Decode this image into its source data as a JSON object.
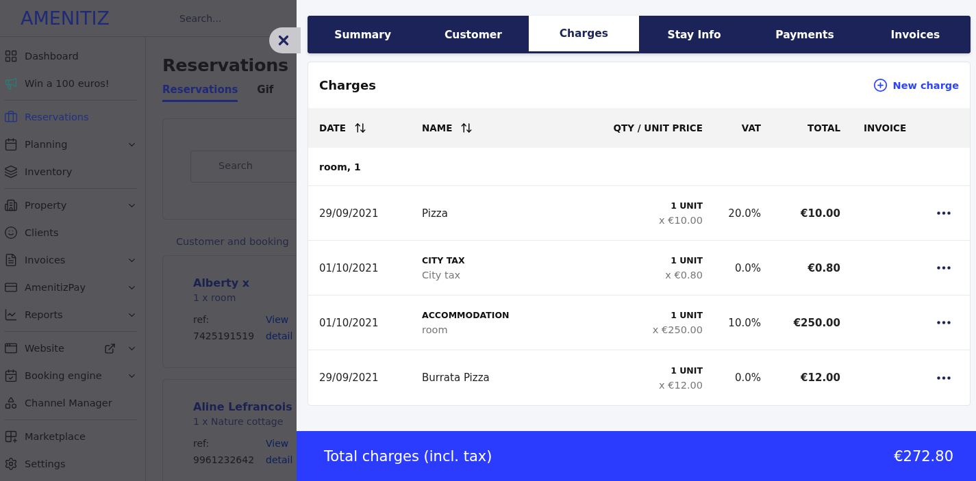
{
  "app": {
    "logo": "AMENITIZ",
    "search_placeholder": "Search..."
  },
  "sidebar": {
    "groups": [
      [
        {
          "label": "Dashboard",
          "selected": false,
          "expandable": false,
          "external": false
        },
        {
          "label": "Win a 100 euros!",
          "selected": false,
          "expandable": false,
          "external": false
        }
      ],
      [
        {
          "label": "Reservations",
          "selected": true,
          "expandable": false,
          "external": false
        },
        {
          "label": "Planning",
          "selected": false,
          "expandable": true,
          "external": false
        },
        {
          "label": "Inventory",
          "selected": false,
          "expandable": false,
          "external": false
        }
      ],
      [
        {
          "label": "Property",
          "selected": false,
          "expandable": true,
          "external": false
        },
        {
          "label": "Clients",
          "selected": false,
          "expandable": false,
          "external": false
        },
        {
          "label": "Invoices",
          "selected": false,
          "expandable": true,
          "external": false
        },
        {
          "label": "AmenitizPay",
          "selected": false,
          "expandable": true,
          "external": false
        },
        {
          "label": "Reports",
          "selected": false,
          "expandable": true,
          "external": false
        }
      ],
      [
        {
          "label": "Website",
          "selected": false,
          "expandable": true,
          "external": true
        },
        {
          "label": "Booking engine",
          "selected": false,
          "expandable": true,
          "external": false
        },
        {
          "label": "Channel Manager",
          "selected": false,
          "expandable": false,
          "external": false
        }
      ],
      [
        {
          "label": "Marketplace",
          "selected": false,
          "expandable": false,
          "external": false
        },
        {
          "label": "Settings",
          "selected": false,
          "expandable": false,
          "external": false
        }
      ]
    ]
  },
  "page": {
    "title": "Reservations",
    "tabs": [
      {
        "label": "Reservations",
        "selected": true
      },
      {
        "label": "Gif",
        "selected": false
      }
    ],
    "search_placeholder": "Search",
    "section_label": "Customer and booking",
    "bookings": [
      {
        "name": "Alberty x",
        "room": "1 x room",
        "ref_label": "ref:",
        "ref": "7425191519",
        "link_1": "View",
        "link_2": "detail"
      },
      {
        "name": "Aline Lefrancois",
        "room": "1 x Nature cottage",
        "ref_label": "ref:",
        "ref": "9961232642",
        "link_1": "View",
        "link_2": "detail"
      }
    ]
  },
  "drawer": {
    "tabs": [
      {
        "label": "Summary",
        "selected": false
      },
      {
        "label": "Customer",
        "selected": false
      },
      {
        "label": "Charges",
        "selected": true
      },
      {
        "label": "Stay Info",
        "selected": false
      },
      {
        "label": "Payments",
        "selected": false
      },
      {
        "label": "Invoices",
        "selected": false
      }
    ],
    "charges": {
      "title": "Charges",
      "new_button": "New charge",
      "columns": [
        {
          "label": "DATE",
          "sortable": true
        },
        {
          "label": "NAME",
          "sortable": true
        },
        {
          "label": "QTY / UNIT PRICE",
          "sortable": false
        },
        {
          "label": "VAT",
          "sortable": false
        },
        {
          "label": "TOTAL",
          "sortable": false
        },
        {
          "label": "INVOICE",
          "sortable": false
        }
      ],
      "group": "room, 1",
      "rows": [
        {
          "date": "29/09/2021",
          "name": "Pizza",
          "quantity": "1 UNIT",
          "unit_price": "x €10.00",
          "vat": "20.0%",
          "total": "€10.00"
        },
        {
          "date": "01/10/2021",
          "category": "CITY TAX",
          "name": "City tax",
          "quantity": "1 UNIT",
          "unit_price": "x €0.80",
          "vat": "0.0%",
          "total": "€0.80"
        },
        {
          "date": "01/10/2021",
          "category": "ACCOMMODATION",
          "name": "room",
          "quantity": "1 UNIT",
          "unit_price": "x €250.00",
          "vat": "10.0%",
          "total": "€250.00"
        },
        {
          "date": "29/09/2021",
          "name": "Burrata Pizza",
          "quantity": "1 UNIT",
          "unit_price": "x €12.00",
          "vat": "0.0%",
          "total": "€12.00"
        }
      ]
    },
    "footer": {
      "label": "Total charges (incl. tax)",
      "amount": "€272.80"
    }
  }
}
